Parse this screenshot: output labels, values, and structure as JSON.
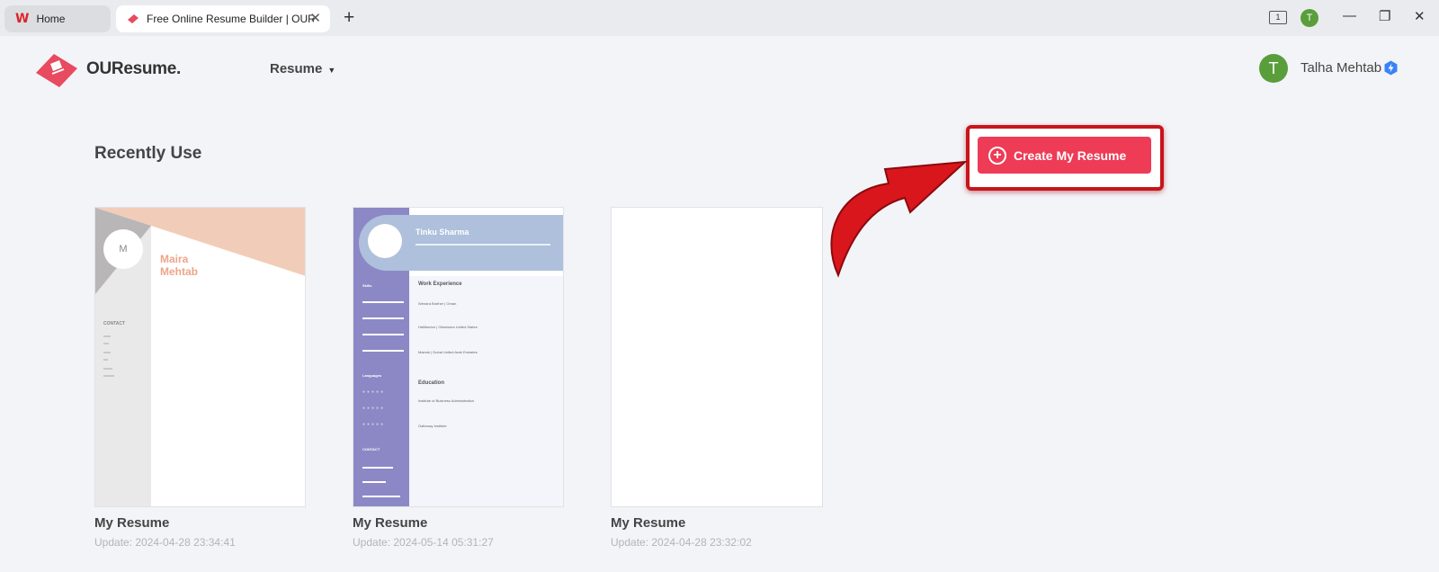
{
  "browser": {
    "tabs": [
      {
        "label": "Home"
      },
      {
        "label": "Free Online Resume Builder | OURe"
      }
    ],
    "new_tab_label": "+",
    "reader_badge": "1",
    "profile_initial": "T",
    "window_controls": {
      "minimize": "—",
      "restore": "❐",
      "close": "✕"
    }
  },
  "header": {
    "brand": "OUResume.",
    "nav_resume": "Resume",
    "user": {
      "initial": "T",
      "name": "Talha Mehtab"
    }
  },
  "main": {
    "section_title": "Recently Use",
    "create_button": "Create My Resume",
    "cards": [
      {
        "label": "My Resume",
        "date": "Update: 2024-04-28 23:34:41"
      },
      {
        "label": "My Resume",
        "date": "Update: 2024-05-14 05:31:27"
      },
      {
        "label": "My Resume",
        "date": "Update: 2024-04-28 23:32:02"
      }
    ]
  },
  "previews": {
    "card1": {
      "initial": "M",
      "first": "Maira",
      "last": "Mehtab",
      "contact": "CONTACT"
    },
    "card2": {
      "name": "Tinku Sharma",
      "sections": {
        "work": "Work Experience",
        "education": "Education",
        "skills": "Skills",
        "languages": "Languages",
        "contact": "CONTACT"
      },
      "jobs": [
        "Wendra Brother | Oman",
        "Halliburton | Oklahoma United States",
        "Maersk | Dubai United Arab Emirates"
      ],
      "schools": [
        "Institute of Business Administration",
        "Galloway Institute"
      ]
    }
  },
  "colors": {
    "accent": "#ee3b56",
    "highlight": "#c9141b",
    "avatar": "#5a9e3b",
    "verified": "#3b82f6"
  }
}
